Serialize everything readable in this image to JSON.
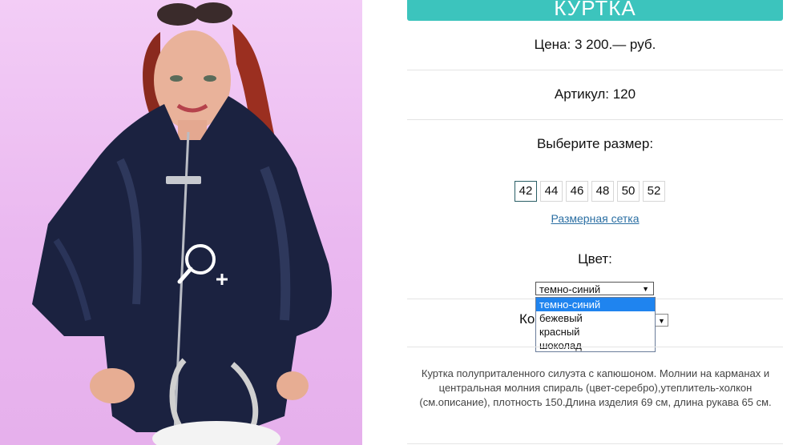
{
  "product": {
    "title": "КУРТКА",
    "price": "Цена: 3 200.— руб.",
    "article": "Артикул: 120",
    "choose_size_label": "Выберите размер:",
    "sizes": [
      "42",
      "44",
      "46",
      "48",
      "50",
      "52"
    ],
    "selected_size": "42",
    "size_chart_link": "Размерная сетка",
    "color_label": "Цвет:",
    "color_select": {
      "value": "темно-синий",
      "options": [
        "темно-синий",
        "бежевый",
        "красный",
        "шоколад"
      ]
    },
    "quantity_label_partial": "Ко",
    "description": "Куртка полуприталенного силуэта с капюшоном. Молнии на карманах и центральная молния спираль (цвет-серебро),утеплитель-холкон (см.описание), плотность 150.Длина изделия 69 см, длина рукава 65 см."
  },
  "icons": {
    "zoom": "zoom-in-icon",
    "dropdown_arrow": "caret-down-icon"
  },
  "colors": {
    "accent": "#3cc4bd",
    "link": "#2b6fa3",
    "dropdown_highlight": "#1f84ef",
    "image_background": "#f0c4f4"
  }
}
